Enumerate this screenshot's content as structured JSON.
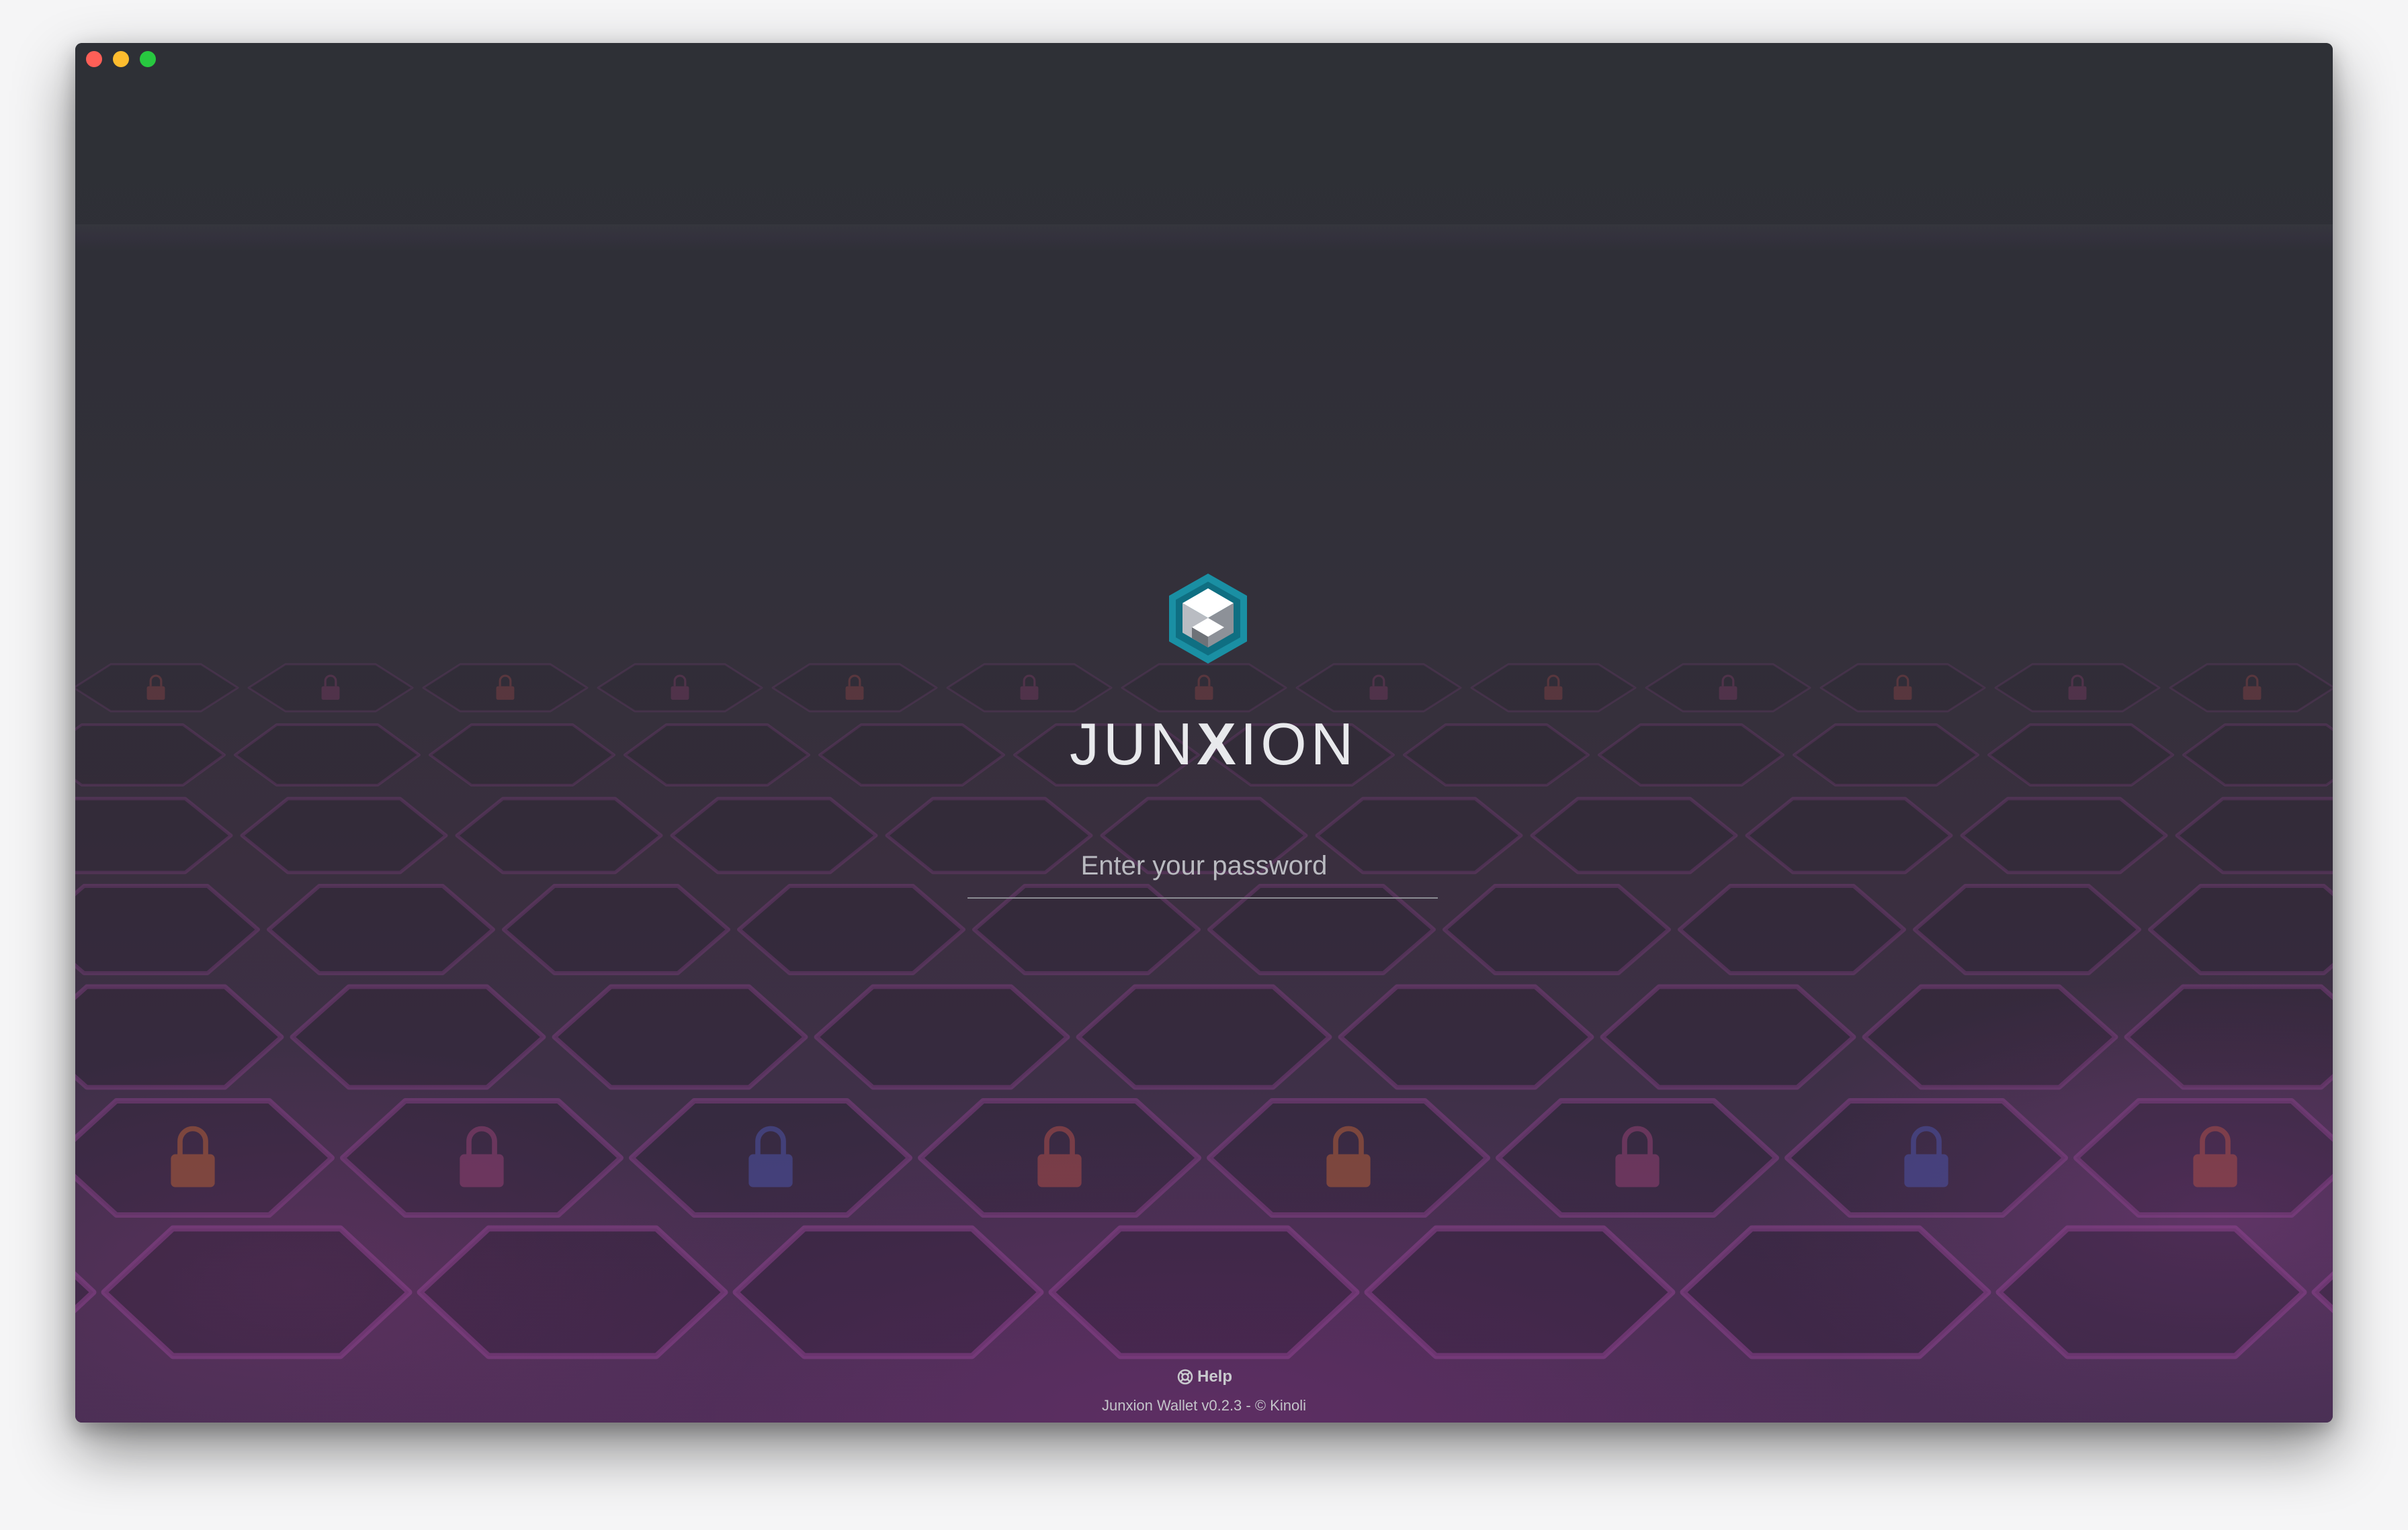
{
  "window": {
    "controls": [
      {
        "name": "close",
        "color": "#ff5f57"
      },
      {
        "name": "minimize",
        "color": "#febc2e"
      },
      {
        "name": "maximize",
        "color": "#28c840"
      }
    ]
  },
  "brand": {
    "name_part1": "JUN",
    "name_x": "X",
    "name_part2": "ION",
    "logo_icon": "hexagon-cube-logo",
    "accent_color": "#1a8fa3"
  },
  "login": {
    "password_placeholder": "Enter your password",
    "password_value": ""
  },
  "help": {
    "label": "Help",
    "icon": "lifebuoy-icon"
  },
  "footer": {
    "text": "Junxion Wallet v0.2.3 - © Kinoli"
  }
}
